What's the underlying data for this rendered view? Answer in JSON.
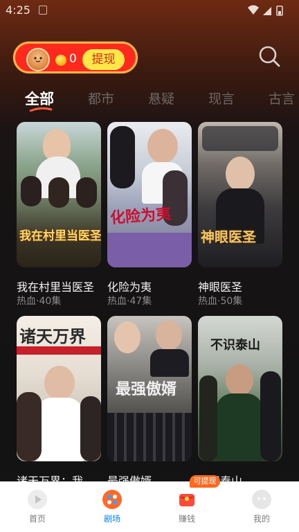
{
  "status": {
    "time": "4:25"
  },
  "header": {
    "coin_count": "0",
    "withdraw_label": "提现"
  },
  "tabs": [
    {
      "label": "全部",
      "active": true
    },
    {
      "label": "都市",
      "active": false
    },
    {
      "label": "悬疑",
      "active": false
    },
    {
      "label": "现言",
      "active": false
    },
    {
      "label": "古言",
      "active": false
    }
  ],
  "dramas": [
    {
      "title": "我在村里当医圣",
      "meta": "热血·40集",
      "poster_text": "我在村里当医圣"
    },
    {
      "title": "化险为夷",
      "meta": "热血·47集",
      "poster_text": "化险为夷"
    },
    {
      "title": "神眼医圣",
      "meta": "热血·50集",
      "poster_text": "神眼医圣"
    },
    {
      "title": "诸天万界：我...",
      "meta": "",
      "poster_text": "诸天万界"
    },
    {
      "title": "最强傲婿",
      "meta": "",
      "poster_text": "最强傲婿"
    },
    {
      "title": "不识泰山",
      "meta": "",
      "poster_text": "不识泰山"
    }
  ],
  "bottom_nav": [
    {
      "label": "首页",
      "icon": "play-icon",
      "active": false
    },
    {
      "label": "剧场",
      "icon": "theater-icon",
      "active": true
    },
    {
      "label": "赚钱",
      "icon": "red-envelope-icon",
      "active": false
    },
    {
      "label": "我的",
      "icon": "profile-icon",
      "active": false
    }
  ],
  "earn_badge": "可提现",
  "colors": {
    "accent_red": "#ff2a1e",
    "accent_yellow": "#ffe74a",
    "nav_active": "#1b7bff",
    "badge_orange": "#ff6a1e"
  }
}
